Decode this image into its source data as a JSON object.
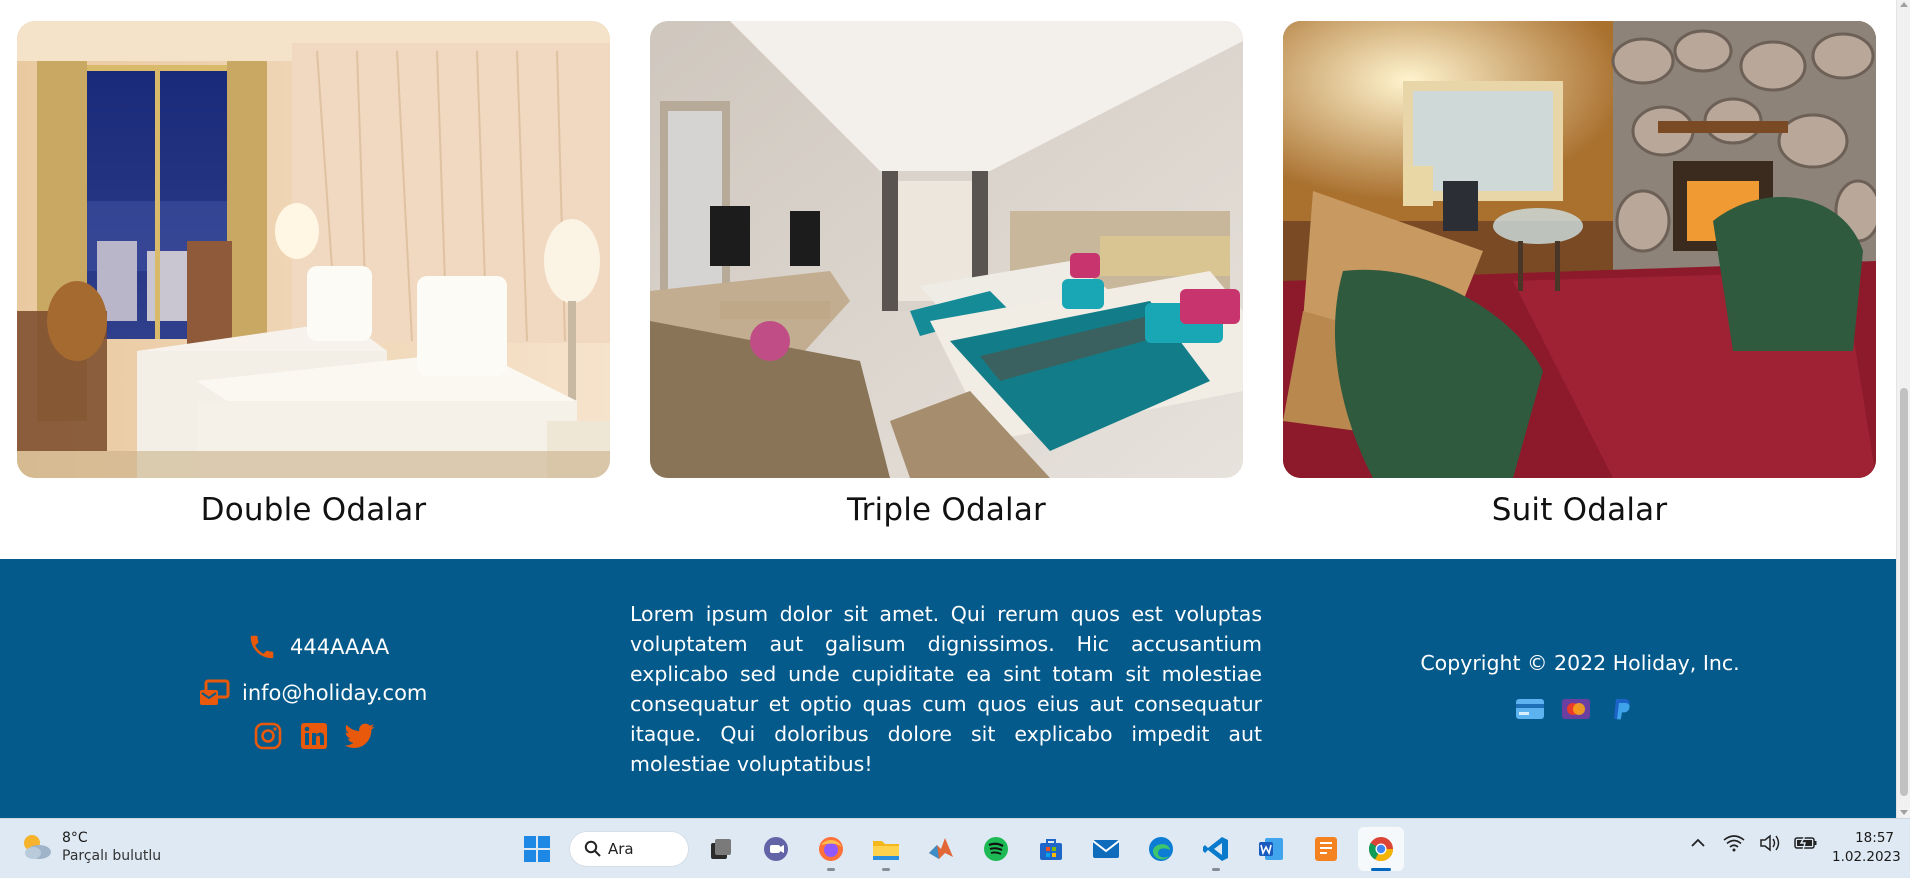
{
  "rooms": [
    {
      "label": "Double Odalar"
    },
    {
      "label": "Triple Odalar"
    },
    {
      "label": "Suit Odalar"
    }
  ],
  "footer": {
    "phone": "444AAAA",
    "email": "info@holiday.com",
    "description": "Lorem ipsum dolor sit amet. Qui rerum quos est voluptas voluptatem aut galisum dignissimos. Hic accusantium explicabo sed unde cupiditate ea sint totam sit molestiae consequatur et optio quas cum quos eius aut consequatur itaque. Qui doloribus dolore sit explicabo impedit aut molestiae voluptatibus!",
    "copyright": "Copyright © 2022 Holiday, Inc.",
    "social_icons": [
      "instagram-icon",
      "linkedin-icon",
      "twitter-icon"
    ],
    "payment_icons": [
      "credit-card-icon",
      "mastercard-icon",
      "paypal-icon"
    ],
    "colors": {
      "background": "#055a8c",
      "accent": "#e8590c",
      "text": "#ffffff"
    }
  },
  "taskbar": {
    "weather": {
      "temp": "8°C",
      "condition": "Parçalı bulutlu"
    },
    "search_label": "Ara",
    "apps": [
      "start-icon",
      "task-view-icon",
      "teams-icon",
      "firefox-icon",
      "file-explorer-icon",
      "matlab-icon",
      "spotify-icon",
      "store-icon",
      "mail-icon",
      "edge-icon",
      "vscode-icon",
      "word-icon",
      "pdf-editor-icon",
      "chrome-icon"
    ],
    "time": "18:57",
    "date": "1.02.2023"
  }
}
